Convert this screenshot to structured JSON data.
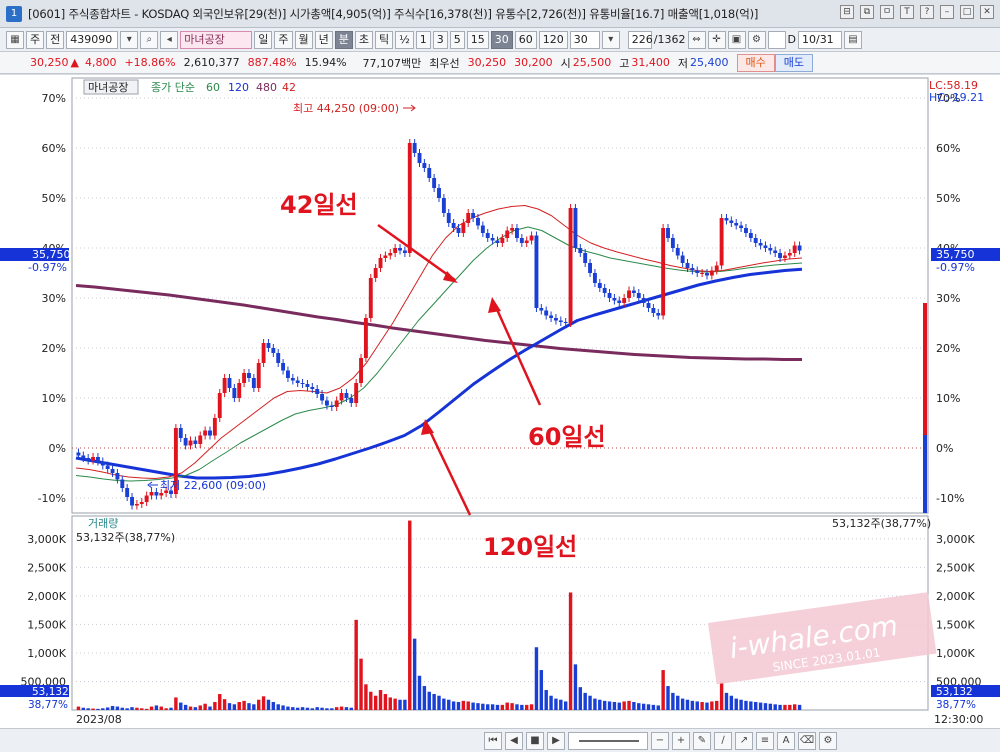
{
  "window": {
    "title": "[0601] 주식종합차트 - KOSDAQ 외국인보유[29(천)] 시가총액[4,905(억)] 주식수[16,378(천)] 유통수[2,726(천)] 유통비율[16.7] 매출액[1,018(억)]",
    "icon_label": "1",
    "controls": [
      "⊟",
      "⧉",
      "ㅁ",
      "T",
      "?",
      "–",
      "□",
      "✕"
    ]
  },
  "toolbar": {
    "period_label": "주",
    "type_label": "전",
    "code": "439090",
    "search_icon": "search-icon",
    "stock_name": "마녀공장",
    "periods": [
      "일",
      "주",
      "월",
      "년",
      "분",
      "초",
      "틱"
    ],
    "selected_period": "분",
    "fraction_label": "½",
    "intervals": [
      "1",
      "3",
      "5",
      "15",
      "30",
      "60",
      "120"
    ],
    "selected_interval": "30",
    "interval_input": "30",
    "count_value": "226",
    "count_total": "/1362",
    "date_value": "10/31",
    "d_label": "D"
  },
  "quote": {
    "price": "30,250",
    "change": "4,800",
    "change_pct": "+18.86%",
    "volume": "2,610,377",
    "turnover_pct": "887.48%",
    "foreign_pct": "15.94%",
    "amount": "77,107백만",
    "best_label": "최우선",
    "best_ask": "30,250",
    "best_bid": "30,200",
    "open_label": "시",
    "open": "25,500",
    "high_label": "고",
    "high": "31,400",
    "low_label": "저",
    "low": "25,400",
    "buy_label": "매수",
    "sell_label": "매도"
  },
  "chart_data": [
    {
      "type": "candlestick",
      "title": "",
      "legend_name": "마녀공장",
      "ma_legend_prefix": "종가 단순",
      "ma_periods": [
        "60",
        "120",
        "480",
        "42"
      ],
      "y_axis_unit": "%",
      "y_ticks": [
        -10,
        0,
        10,
        20,
        30,
        40,
        50,
        60,
        70
      ],
      "ylim": [
        -13,
        74
      ],
      "top_right_labels": [
        "LC:58.19",
        "HC:-19.21"
      ],
      "current_value_label": "35,750",
      "current_change_label": "-0.97%",
      "high_annotation": "최고 44,250 (09:00)",
      "low_annotation": "최저 22,600 (09:00)",
      "closes": [
        -1.5,
        -2,
        -2.5,
        -1.8,
        -2.7,
        -3.5,
        -4.2,
        -5,
        -6.3,
        -8,
        -9.8,
        -11.5,
        -11.2,
        -10.8,
        -9.5,
        -8.8,
        -9.5,
        -9,
        -8.5,
        -9.2,
        4,
        2,
        0.5,
        1.5,
        0.8,
        2.5,
        3.5,
        2.5,
        6,
        11,
        14,
        12,
        10,
        13,
        15,
        14,
        12,
        17,
        21,
        20,
        19,
        17,
        15.5,
        14,
        13.5,
        13,
        12.8,
        12.2,
        11.8,
        10.8,
        9.5,
        8.5,
        8.2,
        9.5,
        11,
        10,
        9,
        13,
        18,
        26,
        34,
        36,
        38,
        38.5,
        39,
        40,
        39.5,
        39,
        61,
        59,
        57,
        56,
        54,
        52,
        50,
        47,
        45,
        44,
        43,
        45,
        47,
        46,
        44.5,
        43,
        42,
        41.5,
        41,
        42,
        43.5,
        44,
        42,
        41,
        41.5,
        42.5,
        28,
        27.5,
        26.5,
        26,
        25.5,
        25.2,
        25,
        48,
        40,
        39,
        37,
        35,
        33,
        32,
        31,
        30,
        29.5,
        29,
        30,
        31.5,
        31,
        30,
        29,
        28,
        27,
        26.5,
        44,
        42,
        40,
        38.5,
        37,
        36,
        35.5,
        35,
        35,
        34.5,
        35.5,
        36.5,
        46,
        45.5,
        45,
        44.5,
        44,
        43,
        42,
        41,
        40.5,
        40,
        39.5,
        39,
        38,
        38.5,
        39,
        40.5,
        39.5
      ],
      "ma_42": [
        -4,
        -4.3,
        -4.8,
        -5.4,
        -5.8,
        -6,
        -6.1,
        -5.8,
        -5,
        -3,
        -0.5,
        2,
        4,
        6,
        8,
        10,
        11.3,
        11.5,
        11.3,
        11,
        12,
        14,
        17,
        21,
        25,
        29.5,
        34,
        38.5,
        42,
        44.5,
        46,
        47,
        47.8,
        48.3,
        48.5,
        47.8,
        46.5,
        44.5,
        42.5,
        41,
        40,
        39.2,
        38.5,
        37.8,
        37.2,
        36.5,
        36,
        35.5,
        35.3,
        35.5,
        36,
        36.5,
        37,
        37.4,
        37.8,
        38
      ],
      "ma_60": [
        -5.5,
        -5.8,
        -6.2,
        -6.5,
        -6.6,
        -6.5,
        -6.3,
        -6,
        -5.5,
        -4.3,
        -2.5,
        -0.8,
        1,
        2.5,
        4,
        5.5,
        6.8,
        7.5,
        8,
        8.6,
        10,
        12,
        15,
        18.5,
        22,
        25.5,
        28.5,
        31.5,
        34.5,
        37.5,
        40,
        42,
        43.5,
        44.2,
        43.5,
        42,
        40.5,
        39.5,
        38.8,
        38,
        37.5,
        37,
        36.5,
        36,
        35.6,
        35.3,
        35.2,
        35.3,
        35.6,
        36,
        36.3,
        36.6,
        36.8,
        37
      ],
      "ma_120": [
        -2,
        -2.6,
        -3.2,
        -3.8,
        -4.4,
        -5,
        -5.6,
        -6,
        -6,
        -5.9,
        -5.7,
        -5.3,
        -4.7,
        -4,
        -3.2,
        -2.2,
        -1.1,
        0,
        1.2,
        2.5,
        4.5,
        7.2,
        10,
        12.8,
        15.2,
        17.5,
        19.6,
        21.6,
        23.6,
        25.5,
        26.6,
        27.6,
        28.6,
        29.6,
        30.6,
        31.6,
        32.6,
        33.4,
        34.1,
        34.7,
        35.1,
        35.5,
        35.75
      ],
      "ma_480": [
        32.5,
        32.2,
        31.8,
        31.4,
        31,
        30.6,
        30.1,
        29.6,
        29.1,
        28.6,
        28,
        27.4,
        26.8,
        26.2,
        25.7,
        25.1,
        24.6,
        24,
        23.5,
        23,
        22.5,
        22,
        21.5,
        21.1,
        20.7,
        20.3,
        19.9,
        19.6,
        19.3,
        19,
        18.7,
        18.5,
        18.3,
        18.1,
        18,
        17.9,
        17.8,
        17.8,
        17.7,
        17.7
      ]
    },
    {
      "type": "bar",
      "title": "",
      "legend_name": "거래량",
      "summary_label": "53,132주(38,77%)",
      "y_ticks": [
        500000,
        1000000,
        1500000,
        2000000,
        2500000,
        3000000
      ],
      "y_tick_labels": [
        "500,000",
        "1,000K",
        "1,500K",
        "2,000K",
        "2,500K",
        "3,000K"
      ],
      "ylim": [
        0,
        3400000
      ],
      "current_value_label": "53,132",
      "current_pct_label": "38,77%",
      "values": [
        60000,
        40000,
        30000,
        25000,
        20000,
        30000,
        45000,
        70000,
        60000,
        40000,
        30000,
        50000,
        40000,
        30000,
        20000,
        60000,
        80000,
        60000,
        30000,
        40000,
        220000,
        130000,
        90000,
        60000,
        50000,
        80000,
        110000,
        60000,
        140000,
        280000,
        190000,
        120000,
        100000,
        140000,
        160000,
        120000,
        100000,
        180000,
        240000,
        180000,
        140000,
        100000,
        80000,
        60000,
        50000,
        40000,
        50000,
        40000,
        30000,
        50000,
        40000,
        30000,
        30000,
        50000,
        60000,
        50000,
        40000,
        1580000,
        900000,
        450000,
        320000,
        250000,
        350000,
        280000,
        220000,
        200000,
        180000,
        180000,
        3320000,
        1250000,
        600000,
        420000,
        320000,
        280000,
        250000,
        200000,
        180000,
        150000,
        140000,
        160000,
        150000,
        130000,
        120000,
        110000,
        100000,
        100000,
        90000,
        90000,
        130000,
        120000,
        100000,
        90000,
        90000,
        100000,
        1100000,
        700000,
        350000,
        250000,
        200000,
        180000,
        150000,
        2060000,
        800000,
        400000,
        300000,
        250000,
        200000,
        180000,
        160000,
        150000,
        140000,
        130000,
        150000,
        160000,
        140000,
        120000,
        110000,
        100000,
        90000,
        80000,
        700000,
        420000,
        300000,
        250000,
        200000,
        180000,
        160000,
        150000,
        140000,
        130000,
        150000,
        160000,
        480000,
        300000,
        250000,
        200000,
        180000,
        160000,
        150000,
        140000,
        130000,
        120000,
        110000,
        100000,
        90000,
        90000,
        90000,
        100000,
        90000
      ]
    }
  ],
  "annotations": {
    "ma42_label": "42일선",
    "ma60_label": "60일선",
    "ma120_label": "120일선",
    "watermark": "i-whale.com",
    "watermark_sub": "SINCE 2023.01.01"
  },
  "x_axis": {
    "start_label": "2023/08",
    "end_label": "12:30:00"
  },
  "colors": {
    "up": "#e0141e",
    "down": "#1a3fd4",
    "ma42": "#d42020",
    "ma60": "#2a8a4a",
    "ma120": "#1533d6",
    "ma480": "#7a2b5e",
    "annotation": "#e0141e",
    "grid": "#c8ccd4"
  }
}
